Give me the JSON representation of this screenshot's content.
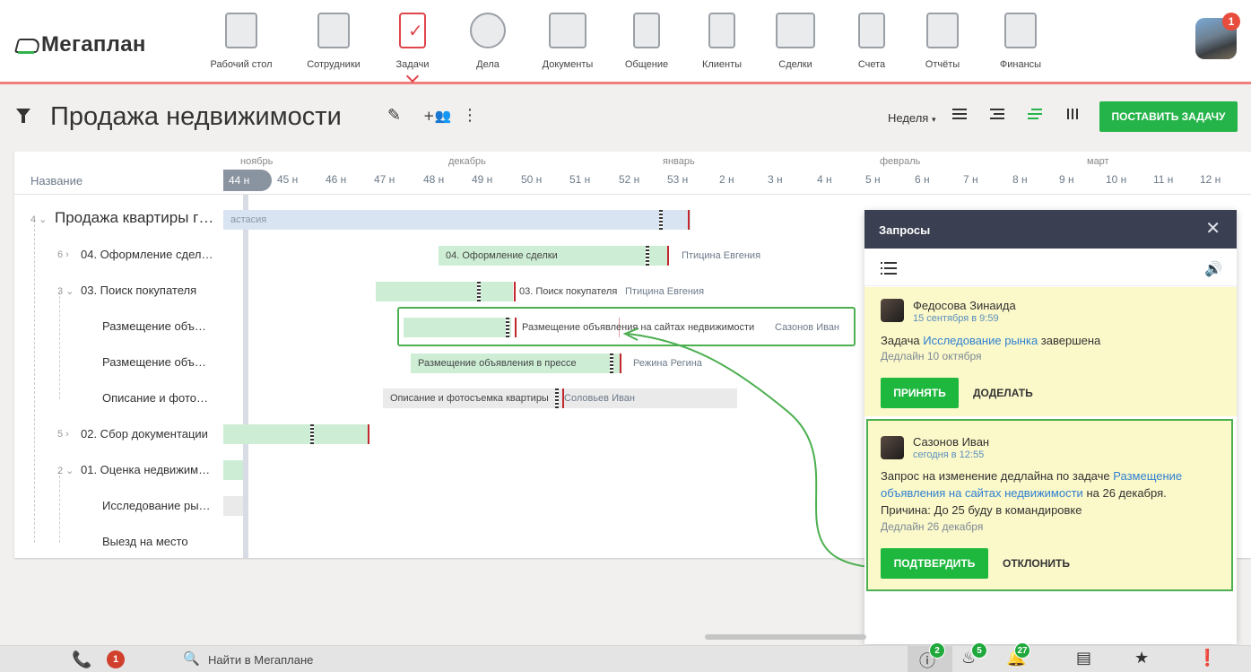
{
  "app": {
    "logo": "Мегаплан"
  },
  "nav": [
    {
      "label": "Рабочий стол",
      "icon": "desktop-icon"
    },
    {
      "label": "Сотрудники",
      "icon": "employees-icon"
    },
    {
      "label": "Задачи",
      "icon": "tasks-icon",
      "active": true
    },
    {
      "label": "Дела",
      "icon": "clock-icon"
    },
    {
      "label": "Документы",
      "icon": "folder-icon"
    },
    {
      "label": "Общение",
      "icon": "chat-icon"
    },
    {
      "label": "Клиенты",
      "icon": "contacts-icon"
    },
    {
      "label": "Сделки",
      "icon": "briefcase-icon"
    },
    {
      "label": "Счета",
      "icon": "invoice-icon"
    },
    {
      "label": "Отчёты",
      "icon": "report-icon"
    },
    {
      "label": "Финансы",
      "icon": "safe-icon"
    }
  ],
  "user": {
    "notifications": "1"
  },
  "title": {
    "text": "Продажа недвижимости",
    "week_select": "Неделя",
    "new_task_button": "ПОСТАВИТЬ ЗАДАЧУ"
  },
  "gantt": {
    "col_name": "Название",
    "months": [
      "ноябрь",
      "декабрь",
      "январь",
      "февраль",
      "март"
    ],
    "current_week": "44 н",
    "weeks": [
      "45 н",
      "46 н",
      "47 н",
      "48 н",
      "49 н",
      "50 н",
      "51 н",
      "52 н",
      "53 н",
      "2 н",
      "3 н",
      "4 н",
      "5 н",
      "6 н",
      "7 н",
      "8 н",
      "9 н",
      "10 н",
      "11 н",
      "12 н"
    ],
    "rows": [
      {
        "num": "4 ⌄",
        "name": "Продажа квартиры г…"
      },
      {
        "num": "6 ›",
        "name": "04. Оформление сдел…"
      },
      {
        "num": "3 ⌄",
        "name": "03. Поиск покупателя"
      },
      {
        "num": "",
        "name": "Размещение объ…"
      },
      {
        "num": "",
        "name": "Размещение объ…"
      },
      {
        "num": "",
        "name": "Описание и фото…"
      },
      {
        "num": "5 ›",
        "name": "02. Сбор документации"
      },
      {
        "num": "2 ⌄",
        "name": "01. Оценка недвижим…"
      },
      {
        "num": "",
        "name": "Исследование ры…"
      },
      {
        "num": "",
        "name": "Выезд на место"
      }
    ],
    "bars": {
      "b0": "астасия",
      "b1": "04. Оформление сделки",
      "b1_who": "Птицина Евгения",
      "b2_label": "03. Поиск покупателя",
      "b2_who": "Птицина Евгения",
      "b3_label": "Размещение объявления на сайтах недвижимости",
      "b3_who": "Сазонов Иван",
      "b4": "Размещение объявления в прессе",
      "b4_who": "Режина Регина",
      "b5": "Описание и фотосъемка квартиры",
      "b5_who": "Соловьев Иван"
    }
  },
  "requests": {
    "title": "Запросы",
    "cards": [
      {
        "author": "Федосова Зинаида",
        "time": "15 сентября в 9:59",
        "text_pre": "Задача",
        "link": "Исследование рынка",
        "text_post": "завершена",
        "deadline": "Дедлайн 10 октября",
        "primary": "ПРИНЯТЬ",
        "secondary": "ДОДЕЛАТЬ"
      },
      {
        "author": "Сазонов Иван",
        "time": "сегодня в 12:55",
        "text_pre": "Запрос на изменение дедлайна по задаче",
        "link": "Размещение объявления на сайтах недвижимости",
        "text_post": "на 26 декабря.",
        "reason": "Причина: До 25 буду в командировке",
        "deadline": "Дедлайн 26 декабря",
        "primary": "ПОДТВЕРДИТЬ",
        "secondary": "ОТКЛОНИТЬ"
      }
    ]
  },
  "bottom": {
    "calls_badge": "1",
    "search_placeholder": "Найти в Мегаплане",
    "requests_badge": "2",
    "fire_badge": "5",
    "bell_badge": "27"
  }
}
